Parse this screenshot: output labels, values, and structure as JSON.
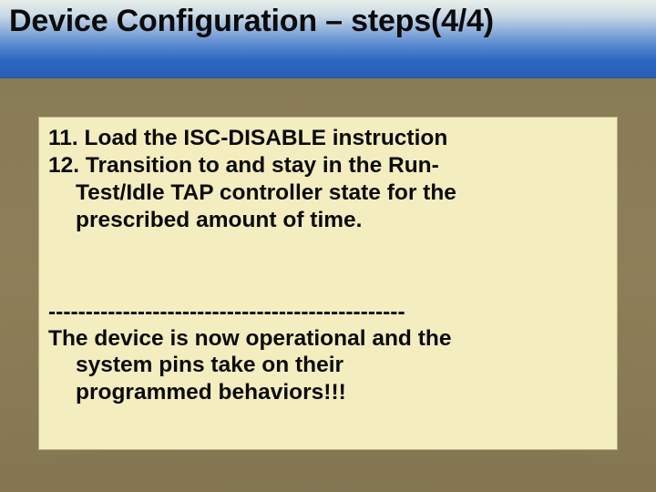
{
  "slide": {
    "title": "Device Configuration – steps(4/4)"
  },
  "content": {
    "item11": "11. Load the ISC-DISABLE instruction",
    "item12_l1": "12. Transition to and stay in the Run-",
    "item12_l2": "Test/Idle TAP controller state for the",
    "item12_l3": "prescribed amount of time.",
    "divider": "------------------------------------------------",
    "conc_l1": "The device is now operational and the",
    "conc_l2": "system pins take on their",
    "conc_l3": "programmed behaviors!!!"
  }
}
